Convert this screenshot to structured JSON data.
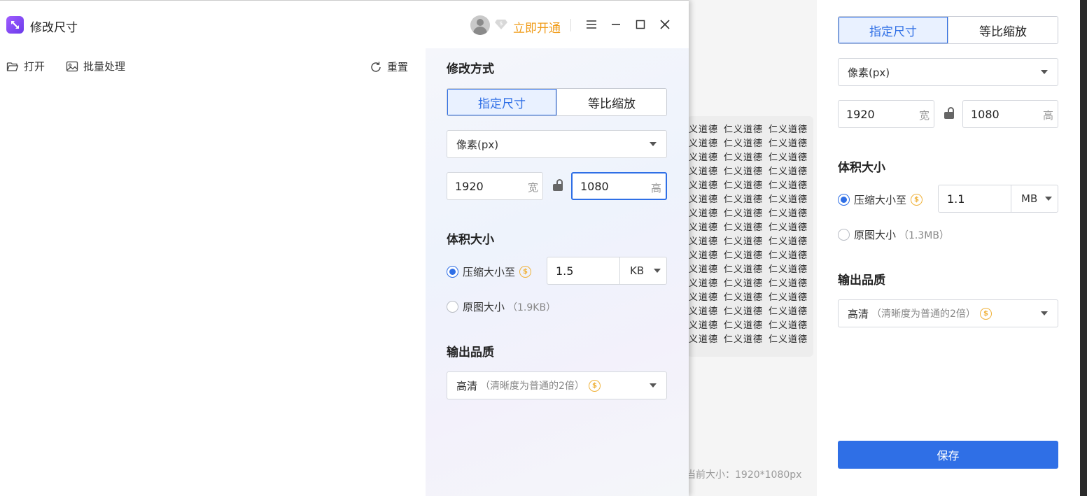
{
  "bg_window": {
    "preview_rows": 16,
    "preview_glyphs": [
      "仁",
      "义",
      "道",
      "德"
    ],
    "current_size": "当前大小：1920*1080px",
    "mode_tabs": [
      "指定尺寸",
      "等比缩放"
    ],
    "unit_select": "像素(px)",
    "width_value": "1920",
    "width_suffix": "宽",
    "height_value": "1080",
    "height_suffix": "高",
    "volume_title": "体积大小",
    "compress_label": "压缩大小至",
    "compress_value": "1.1",
    "compress_unit": "MB",
    "original_label": "原图大小",
    "original_size": "（1.3MB）",
    "quality_title": "输出品质",
    "quality_value": "高清",
    "quality_sub": "（清晰度为普通的2倍）",
    "save_label": "保存"
  },
  "main_window": {
    "title": "修改尺寸",
    "upgrade_label": "立即开通",
    "toolbar": {
      "open_label": "打开",
      "batch_label": "批量处理",
      "reset_label": "重置"
    },
    "panel": {
      "mode_title": "修改方式",
      "mode_tabs": [
        "指定尺寸",
        "等比缩放"
      ],
      "unit_select": "像素(px)",
      "width_value": "1920",
      "width_suffix": "宽",
      "height_value": "1080",
      "height_suffix": "高",
      "volume_title": "体积大小",
      "compress_label": "压缩大小至",
      "compress_value": "1.5",
      "compress_unit": "KB",
      "original_label": "原图大小",
      "original_size": "（1.9KB）",
      "quality_title": "输出品质",
      "quality_value": "高清",
      "quality_sub": "（清晰度为普通的2倍）"
    }
  },
  "colors": {
    "accent": "#2f6fe6",
    "vip_gold": "#f0b23a",
    "upgrade_orange": "#f09c1a",
    "logo_purple": "#8a4cf5"
  }
}
